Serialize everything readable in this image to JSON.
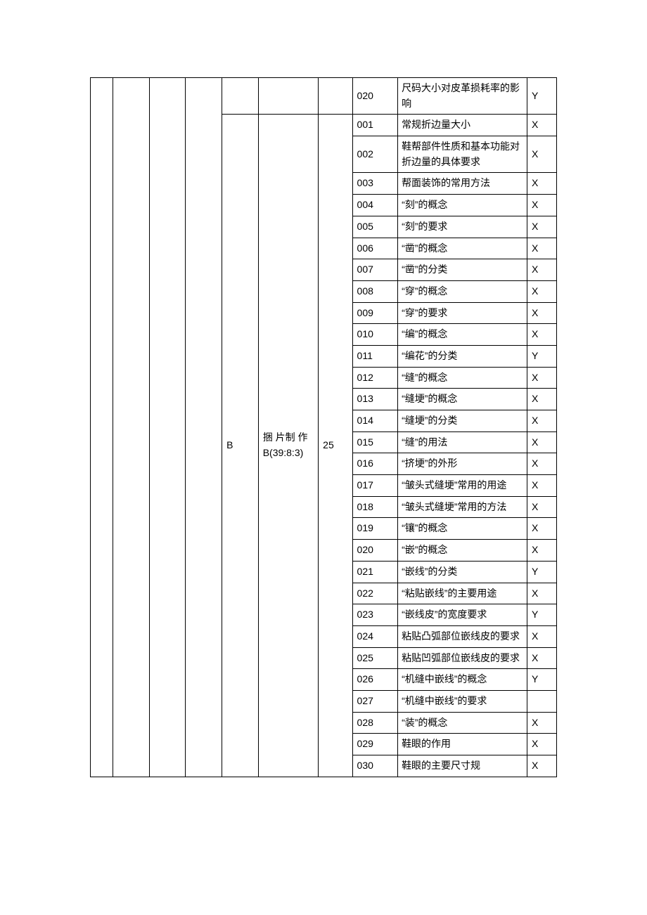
{
  "outer_cols": {
    "col1": "",
    "col2": "",
    "col3": "",
    "col4": ""
  },
  "section_top": {
    "col5": "",
    "col6": "",
    "col7": "",
    "row": {
      "num": "020",
      "desc": "尺码大小对皮革损耗率的影响",
      "flag": "Y"
    }
  },
  "section_main": {
    "col5": "B",
    "col6": "捆 片制 作B(39:8:3)",
    "col7": "25",
    "rows": [
      {
        "num": "001",
        "desc": "常规折边量大小",
        "flag": "X"
      },
      {
        "num": "002",
        "desc": "鞋帮部件性质和基本功能对折边量的具体要求",
        "flag": "X"
      },
      {
        "num": "003",
        "desc": "帮面装饰的常用方法",
        "flag": "X"
      },
      {
        "num": "004",
        "desc": "“刻”的概念",
        "flag": "X"
      },
      {
        "num": "005",
        "desc": "“刻”的要求",
        "flag": "X"
      },
      {
        "num": "006",
        "desc": "“凿”的概念",
        "flag": "X"
      },
      {
        "num": "007",
        "desc": "“凿”的分类",
        "flag": "X"
      },
      {
        "num": "008",
        "desc": "“穿”的概念",
        "flag": "X"
      },
      {
        "num": "009",
        "desc": "“穿”的要求",
        "flag": "X"
      },
      {
        "num": "010",
        "desc": "“编”的概念",
        "flag": "X"
      },
      {
        "num": "011",
        "desc": "“编花”的分类",
        "flag": "Y"
      },
      {
        "num": "012",
        "desc": "“缝”的概念",
        "flag": "X"
      },
      {
        "num": "013",
        "desc": "“缝埂”的概念",
        "flag": "X"
      },
      {
        "num": "014",
        "desc": "“缝埂”的分类",
        "flag": "X"
      },
      {
        "num": "015",
        "desc": "“缝”的用法",
        "flag": "X"
      },
      {
        "num": "016",
        "desc": "“挤埂”的外形",
        "flag": "X"
      },
      {
        "num": "017",
        "desc": "“皱头式缝埂”常用的用途",
        "flag": "X"
      },
      {
        "num": "018",
        "desc": "“皱头式缝埂”常用的方法",
        "flag": "X"
      },
      {
        "num": "019",
        "desc": "“镶”的概念",
        "flag": "X"
      },
      {
        "num": "020",
        "desc": "“嵌”的概念",
        "flag": "X"
      },
      {
        "num": "021",
        "desc": "“嵌线”的分类",
        "flag": "Y"
      },
      {
        "num": "022",
        "desc": "“粘贴嵌线”的主要用途",
        "flag": "X"
      },
      {
        "num": "023",
        "desc": "“嵌线皮”的宽度要求",
        "flag": "Y"
      },
      {
        "num": "024",
        "desc": "粘贴凸弧部位嵌线皮的要求",
        "flag": "X"
      },
      {
        "num": "025",
        "desc": "粘贴凹弧部位嵌线皮的要求",
        "flag": "X"
      },
      {
        "num": "026",
        "desc": "“机缝中嵌线”的概念",
        "flag": "Y"
      },
      {
        "num": "027",
        "desc": "“机缝中嵌线”的要求",
        "flag": ""
      },
      {
        "num": "028",
        "desc": "“装”的概念",
        "flag": "X"
      },
      {
        "num": "029",
        "desc": "鞋眼的作用",
        "flag": "X"
      },
      {
        "num": "030",
        "desc": "鞋眼的主要尺寸规",
        "flag": "X"
      }
    ]
  }
}
